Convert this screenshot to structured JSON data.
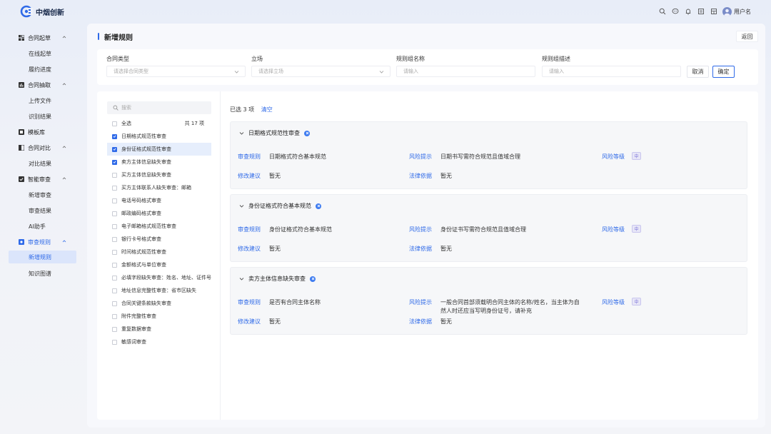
{
  "app": {
    "logo_text": "中烟创新",
    "username": "用户名"
  },
  "topbar": {
    "icons": [
      "search-icon",
      "message-icon",
      "bell-icon",
      "document-icon",
      "grid-icon",
      "avatar"
    ]
  },
  "sidebar": {
    "groups": [
      {
        "label": "合同起草",
        "icon": "grid-icon",
        "items": [
          "在线起草",
          "履约进度"
        ]
      },
      {
        "label": "合同抽取",
        "icon": "chart-icon",
        "items": [
          "上传文件",
          "识别结果"
        ]
      },
      {
        "label": "模板库",
        "icon": "template-icon",
        "items": []
      },
      {
        "label": "合同对比",
        "icon": "compare-icon",
        "items": [
          "对比结果"
        ]
      },
      {
        "label": "智能审查",
        "icon": "review-icon",
        "items": [
          "新增审查",
          "审查结果",
          "AI助手"
        ]
      },
      {
        "label": "审查规则",
        "icon": "rule-icon",
        "items": [
          "新增规则",
          "知识图谱"
        ]
      }
    ],
    "active_item": "新增规则"
  },
  "header": {
    "title": "新增规则",
    "back_label": "返回"
  },
  "form": {
    "contract_type": {
      "label": "合同类型",
      "placeholder": "请选择合同类型"
    },
    "stance": {
      "label": "立场",
      "placeholder": "请选择立场"
    },
    "group_name": {
      "label": "规则组名称",
      "placeholder": "请输入"
    },
    "group_desc": {
      "label": "规则组描述",
      "placeholder": "请输入"
    },
    "cancel_label": "取消",
    "ok_label": "确定"
  },
  "rule_list": {
    "search_placeholder": "搜索",
    "select_all_label": "全选",
    "total_label": "共 17 项",
    "items": [
      {
        "label": "日期格式规范性审查",
        "checked": true,
        "highlight": false
      },
      {
        "label": "身份证格式规范性审查",
        "checked": true,
        "highlight": true
      },
      {
        "label": "卖方主体信息缺失审查",
        "checked": true,
        "highlight": false
      },
      {
        "label": "买方主体信息缺失审查",
        "checked": false,
        "highlight": false
      },
      {
        "label": "买方主体联系人缺失审查：邮箱",
        "checked": false,
        "highlight": false
      },
      {
        "label": "电话号码格式审查",
        "checked": false,
        "highlight": false
      },
      {
        "label": "邮政编码格式审查",
        "checked": false,
        "highlight": false
      },
      {
        "label": "电子邮箱格式规范性审查",
        "checked": false,
        "highlight": false
      },
      {
        "label": "银行卡号格式审查",
        "checked": false,
        "highlight": false
      },
      {
        "label": "时间格式规范性审查",
        "checked": false,
        "highlight": false
      },
      {
        "label": "金额格式与单位审查",
        "checked": false,
        "highlight": false
      },
      {
        "label": "必填字段缺失审查：姓名、地址、证件号",
        "checked": false,
        "highlight": false
      },
      {
        "label": "地址信息完整性审查：省市区缺失",
        "checked": false,
        "highlight": false
      },
      {
        "label": "合同关键条款缺失审查",
        "checked": false,
        "highlight": false
      },
      {
        "label": "附件完整性审查",
        "checked": false,
        "highlight": false
      },
      {
        "label": "重复数据审查",
        "checked": false,
        "highlight": false
      },
      {
        "label": "敏感词审查",
        "checked": false,
        "highlight": false
      }
    ]
  },
  "selected": {
    "summary": "已选 3 项",
    "clear_label": "清空",
    "keys": {
      "rule": "审查规则",
      "risk_tip": "风险提示",
      "risk_level": "风险等级",
      "suggestion": "修改建议",
      "legal_basis": "法律依据"
    },
    "rules": [
      {
        "title": "日期格式规范性审查",
        "rule": "日期格式符合基本规范",
        "risk_tip": "日期书写需符合规范且值域合理",
        "risk_tip_line2": "",
        "level": "中",
        "suggestion": "暂无",
        "legal_basis": "暂无"
      },
      {
        "title": "身份证格式符合基本规范",
        "rule": "身份证格式符合基本规范",
        "risk_tip": "身份证书写需符合规范且值域合理",
        "risk_tip_line2": "",
        "level": "中",
        "suggestion": "暂无",
        "legal_basis": "暂无"
      },
      {
        "title": "卖方主体信息缺失审查",
        "rule": "是否有合同主体名称",
        "risk_tip": "一般合同首部须载明合同主体的名称/姓名，当主体为自",
        "risk_tip_line2": "然人时还应当写明身份证号，请补充",
        "level": "中",
        "suggestion": "暂无",
        "legal_basis": "暂无"
      }
    ]
  },
  "colors": {
    "accent": "#2f6ae8",
    "level_badge": "#7b72d8"
  }
}
